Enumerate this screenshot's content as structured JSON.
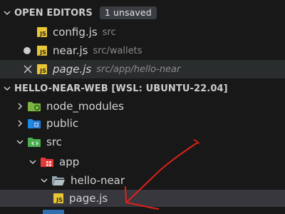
{
  "open_editors": {
    "title": "OPEN EDITORS",
    "badge": "1 unsaved",
    "items": [
      {
        "name": "config.js",
        "path": "src",
        "icon": "javascript-file-icon",
        "state": "normal"
      },
      {
        "name": "near.js",
        "path": "src/wallets",
        "icon": "javascript-file-icon",
        "state": "unsaved"
      },
      {
        "name": "page.js",
        "path": "src/app/hello-near",
        "icon": "javascript-file-icon",
        "state": "active-preview"
      }
    ]
  },
  "workspace": {
    "title": "HELLO-NEAR-WEB [WSL: UBUNTU-22.04]",
    "tree": [
      {
        "name": "node_modules",
        "icon": "node-folder-icon",
        "expanded": false,
        "depth": 1
      },
      {
        "name": "public",
        "icon": "public-folder-icon",
        "expanded": false,
        "depth": 1
      },
      {
        "name": "src",
        "icon": "src-folder-icon",
        "expanded": true,
        "depth": 1
      },
      {
        "name": "app",
        "icon": "app-folder-icon",
        "expanded": true,
        "depth": 2
      },
      {
        "name": "hello-near",
        "icon": "folder-open-icon",
        "expanded": true,
        "depth": 3
      },
      {
        "name": "page.js",
        "icon": "javascript-file-icon",
        "depth": 4,
        "selected": true
      }
    ]
  },
  "colors": {
    "background": "#181818",
    "selection": "#37373d",
    "js_icon": "#e8c634",
    "annotation_arrow": "#e0201a"
  }
}
